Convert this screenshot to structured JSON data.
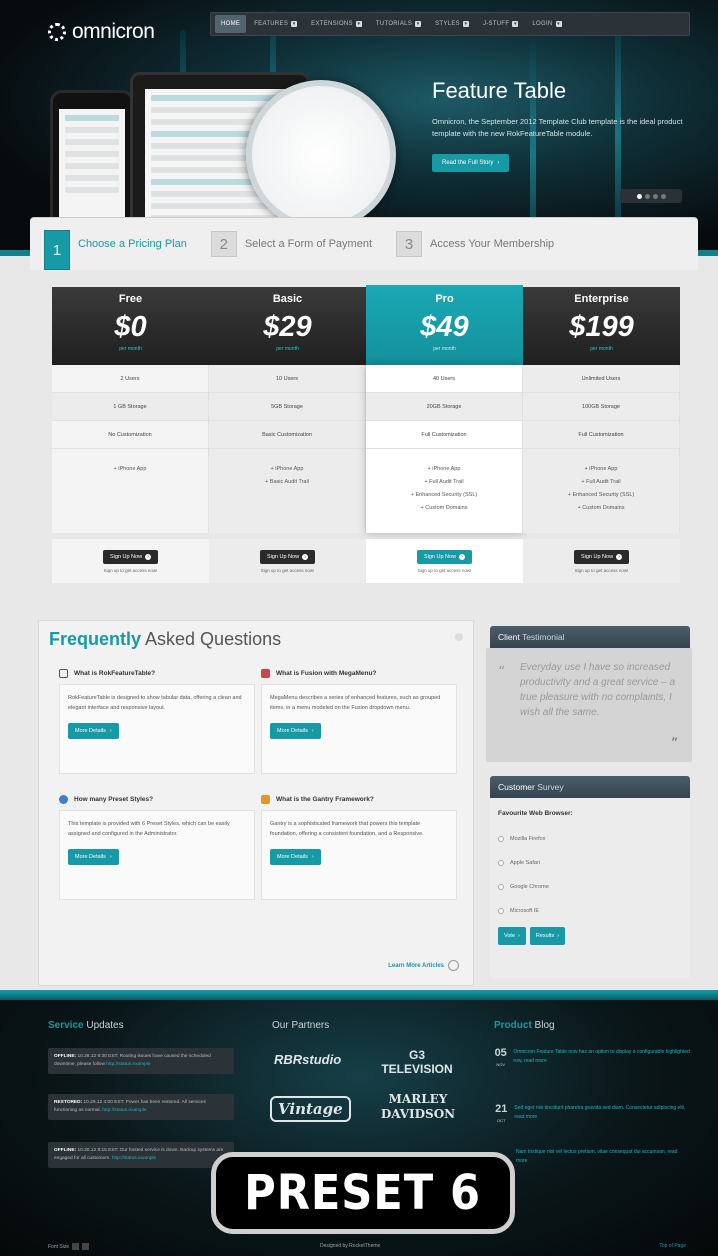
{
  "brand": {
    "logo_text": "omnicron"
  },
  "nav": {
    "items": [
      {
        "label": "HOME",
        "active": true
      },
      {
        "label": "FEATURES",
        "active": false
      },
      {
        "label": "EXTENSIONS",
        "active": false
      },
      {
        "label": "TUTORIALS",
        "active": false
      },
      {
        "label": "STYLES",
        "active": false
      },
      {
        "label": "J-STUFF",
        "active": false
      },
      {
        "label": "LOGIN",
        "active": false
      }
    ]
  },
  "hero": {
    "title": "Feature Table",
    "text": "Omnicron, the September 2012 Template Club template is the ideal product template with the new RokFeatureTable module.",
    "button": "Read the Full Story"
  },
  "steps": [
    {
      "num": "1",
      "label": "Choose a Pricing Plan"
    },
    {
      "num": "2",
      "label": "Select a Form of Payment"
    },
    {
      "num": "3",
      "label": "Access Your Membership"
    }
  ],
  "pricing": [
    {
      "name": "Free",
      "price": "$0",
      "per": "per month",
      "users": "2 Users",
      "storage": "1 GB Storage",
      "custom": "No Customization",
      "features": [
        "+ iPhone App"
      ],
      "button": "Sign Up Now",
      "note": "Sign up to get access now!"
    },
    {
      "name": "Basic",
      "price": "$29",
      "per": "per month",
      "users": "10 Users",
      "storage": "5GB Storage",
      "custom": "Basic Customization",
      "features": [
        "+ iPhone App",
        "+ Basic Audit Trail"
      ],
      "button": "Sign Up Now",
      "note": "Sign up to get access now!"
    },
    {
      "name": "Pro",
      "price": "$49",
      "per": "per month",
      "users": "40 Users",
      "storage": "20GB Storage",
      "custom": "Full Customization",
      "features": [
        "+ iPhone App",
        "+ Full Audit Trail",
        "+ Enhanced Security (SSL)",
        "+ Custom Domains"
      ],
      "button": "Sign Up Now",
      "note": "Sign up to get access now!"
    },
    {
      "name": "Enterprise",
      "price": "$199",
      "per": "per month",
      "users": "Unlimited Users",
      "storage": "100GB Storage",
      "custom": "Full Customization",
      "features": [
        "+ iPhone App",
        "+ Full Audit Trail",
        "+ Enhanced Security (SSL)",
        "+ Custom Domains"
      ],
      "button": "Sign Up Now",
      "note": "Sign up to get access now!"
    }
  ],
  "faq": {
    "title_hl": "Frequently",
    "title_rest": " Asked Questions",
    "questions": [
      {
        "q": "What is RokFeatureTable?",
        "a": "RokFeatureTable is designed to show tabular data, offering a clean and elegant interface and responsive layout.",
        "button": "More Details"
      },
      {
        "q": "What is Fusion with MegaMenu?",
        "a": "MegaMenu describes a series of enhanced features, such as grouped items, in a menu modeled on the Fusion dropdown menu.",
        "button": "More Details"
      },
      {
        "q": "How many Preset Styles?",
        "a": "This template is provided with 6 Preset Styles, which can be easily assigned and configured in the Administrator.",
        "button": "More Details"
      },
      {
        "q": "What is the Gantry Framework?",
        "a": "Gantry is a sophisticated framework that powers this template foundation, offering a consistent foundation, and a Responsive.",
        "button": "More Details"
      }
    ],
    "learn_more": "Learn More Articles"
  },
  "testimonial": {
    "title_hl": "Client",
    "title_rest": " Testimonial",
    "text": "Everyday use I have so increased productivity and a great service – a true pleasure with no complaints, I wish all the same."
  },
  "survey": {
    "title_hl": "Customer",
    "title_rest": " Survey",
    "question": "Favourite Web Browser:",
    "options": [
      "Mozilla Firefox",
      "Apple Safari",
      "Google Chrome",
      "Microsoft IE"
    ],
    "vote": "Vote",
    "results": "Results"
  },
  "footer": {
    "service_title_hl": "Service",
    "service_title_rest": " Updates",
    "updates": [
      {
        "tag": "OFFLINE:",
        "text": "10.28.12 9:30 EST: Routing issues have caused the scheduled downtime, please follow ",
        "link": "http://status.example"
      },
      {
        "tag": "RESTORED:",
        "text": "10.29.12 4:00 EST: Power has been restored. All services functioning as normal. ",
        "link": "http://status.example"
      },
      {
        "tag": "OFFLINE:",
        "text": "10.30.12 8:15 EST: Our hosted service is down. Backup systems are engaged for all customers. ",
        "link": "http://status.example"
      }
    ],
    "partners_title": "Our Partners",
    "partners": [
      "RBRstudio",
      "G3 TELEVISION",
      "Vintage",
      "MARLEY DAVIDSON"
    ],
    "blog_title_hl": "Product",
    "blog_title_rest": " Blog",
    "posts": [
      {
        "day": "05",
        "month": "NOV",
        "text": "Omnicron Feature Table now has an option to display a configurable highlighted row, read more"
      },
      {
        "day": "21",
        "month": "OCT",
        "text": "Sed eget nisi tincidunt pharetra gravida sed diam. Consectetur adipiscing elit, read more"
      },
      {
        "day": "",
        "month": "",
        "text": "Nam tristique nisl vel lectus pretium, vitae consequat dui accumsan, read more"
      }
    ]
  },
  "watermark": "PRESET 6",
  "bottom": {
    "left": "Font Size",
    "center": "Designed by RocketTheme",
    "right": "Top of Page"
  }
}
